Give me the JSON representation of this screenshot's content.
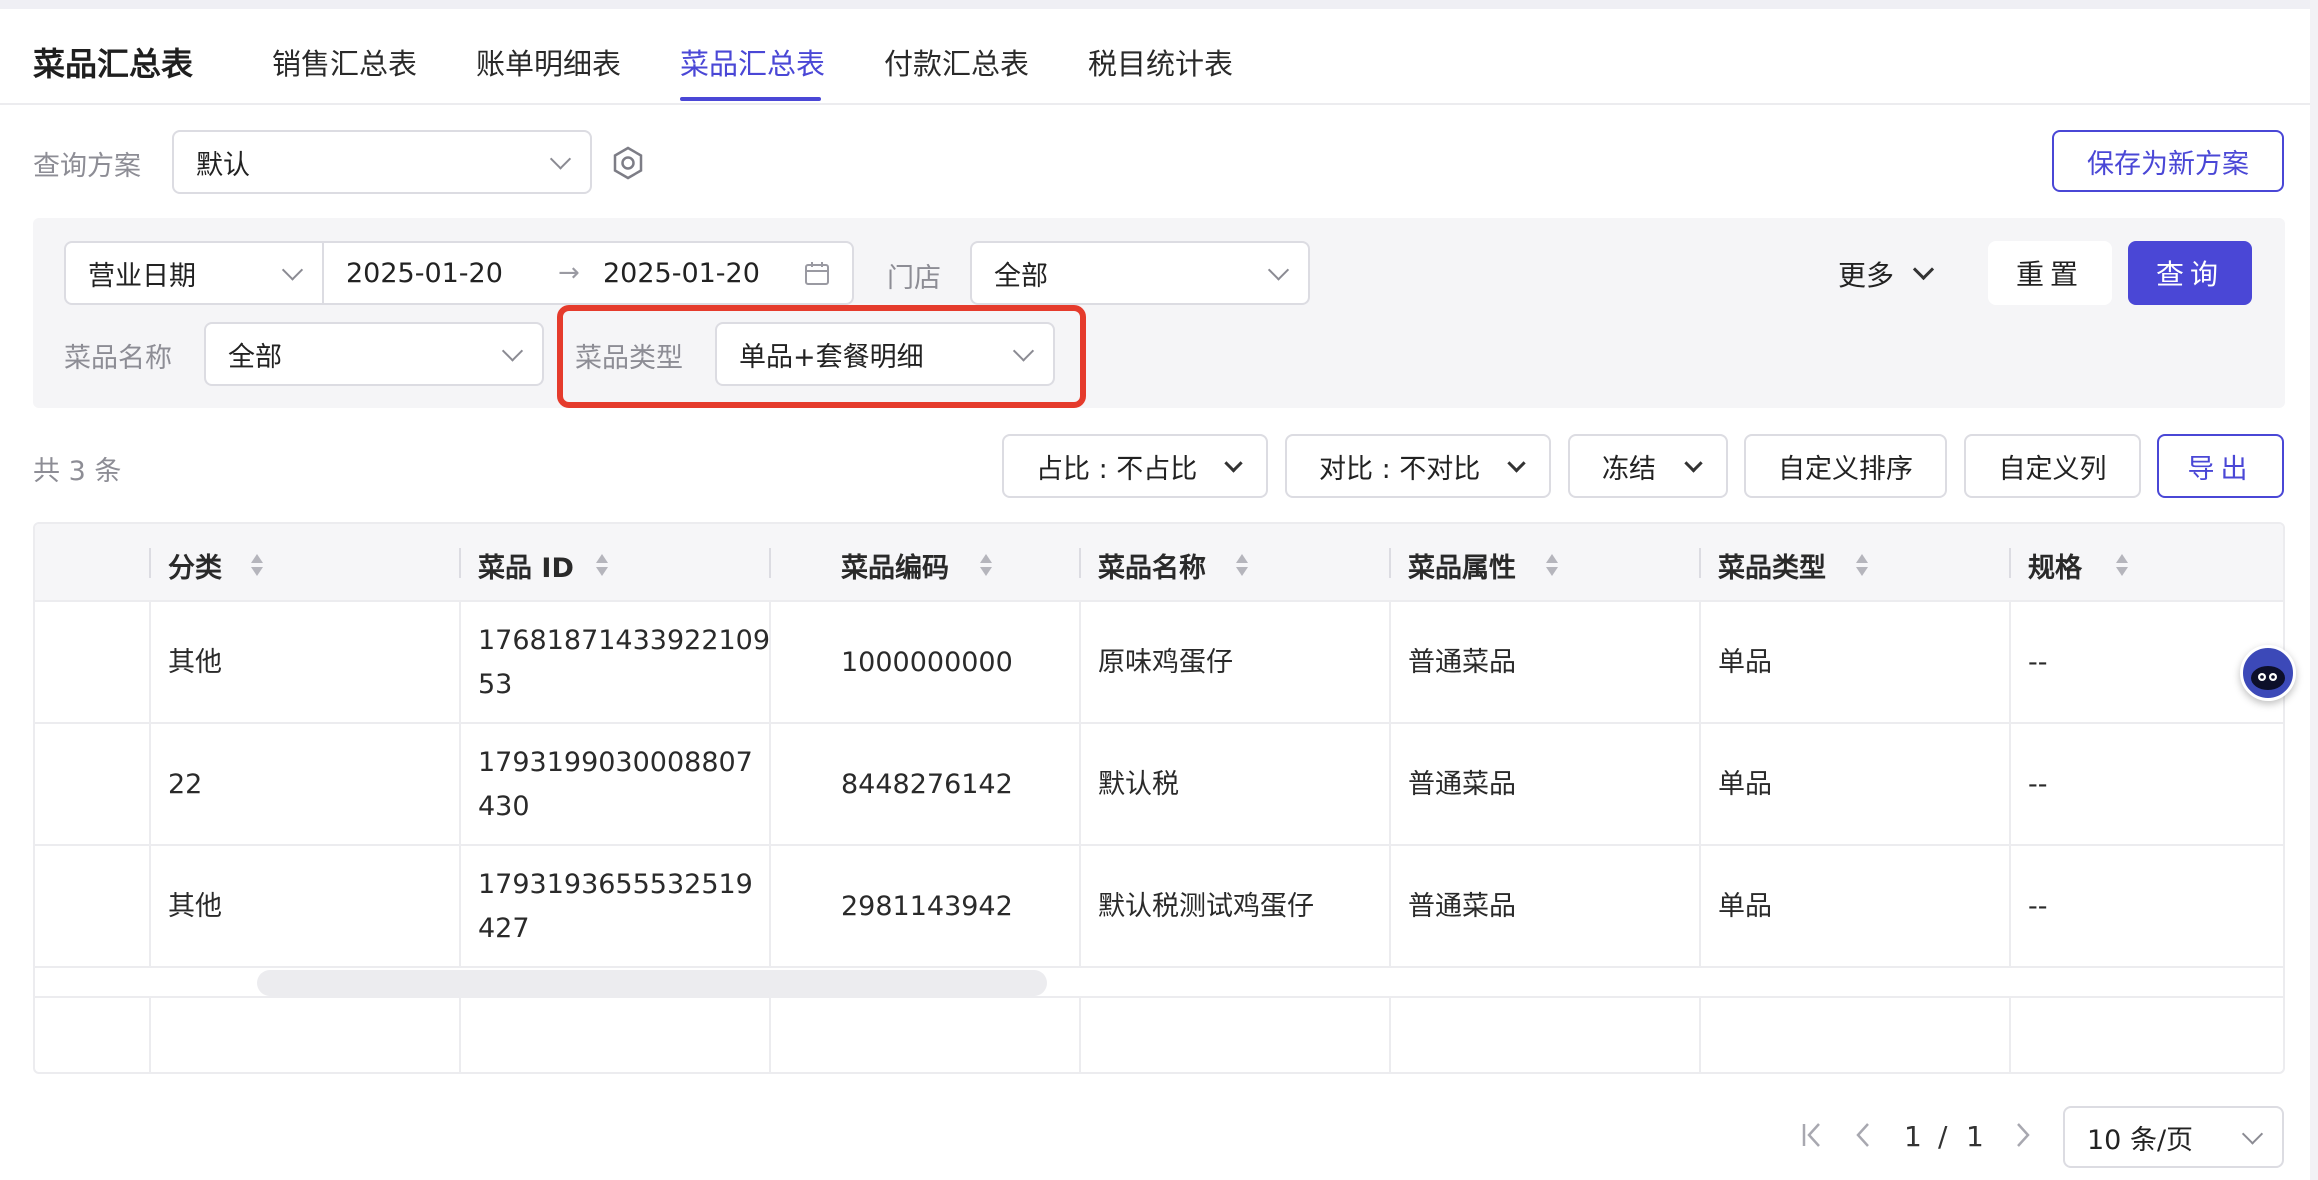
{
  "header": {
    "page_title": "菜品汇总表",
    "tabs": [
      {
        "label": "销售汇总表",
        "active": false
      },
      {
        "label": "账单明细表",
        "active": false
      },
      {
        "label": "菜品汇总表",
        "active": true
      },
      {
        "label": "付款汇总表",
        "active": false
      },
      {
        "label": "税目统计表",
        "active": false
      }
    ]
  },
  "scheme": {
    "label": "查询方案",
    "value": "默认",
    "save_label": "保存为新方案"
  },
  "filters": {
    "date_type": "营业日期",
    "date_start": "2025-01-20",
    "date_arrow": "→",
    "date_end": "2025-01-20",
    "store_label": "门店",
    "store_value": "全部",
    "more_label": "更多",
    "reset_label": "重置",
    "query_label": "查询",
    "dish_name_label": "菜品名称",
    "dish_name_value": "全部",
    "dish_type_label": "菜品类型",
    "dish_type_value": "单品+套餐明细"
  },
  "toolbar": {
    "count_text": "共 3 条",
    "ratio": "占比 : 不占比",
    "compare": "对比 : 不对比",
    "freeze": "冻结",
    "custom_sort": "自定义排序",
    "custom_columns": "自定义列",
    "export": "导出"
  },
  "table": {
    "columns": [
      "分类",
      "菜品 ID",
      "菜品编码",
      "菜品名称",
      "菜品属性",
      "菜品类型",
      "规格"
    ],
    "rows": [
      {
        "category": "其他",
        "id_line1": "17681871433922109",
        "id_line2": "53",
        "code": "1000000000",
        "name": "原味鸡蛋仔",
        "attr": "普通菜品",
        "type": "单品",
        "spec": "--"
      },
      {
        "category": "22",
        "id_line1": "1793199030008807",
        "id_line2": "430",
        "code": "8448276142",
        "name": "默认税",
        "attr": "普通菜品",
        "type": "单品",
        "spec": "--"
      },
      {
        "category": "其他",
        "id_line1": "1793193655532519",
        "id_line2": "427",
        "code": "2981143942",
        "name": "默认税测试鸡蛋仔",
        "attr": "普通菜品",
        "type": "单品",
        "spec": "--"
      }
    ]
  },
  "pagination": {
    "current": "1",
    "separator": "/",
    "total": "1",
    "page_size": "10 条/页"
  },
  "colors": {
    "accent": "#4a47d6",
    "highlight": "#e53b2c"
  }
}
